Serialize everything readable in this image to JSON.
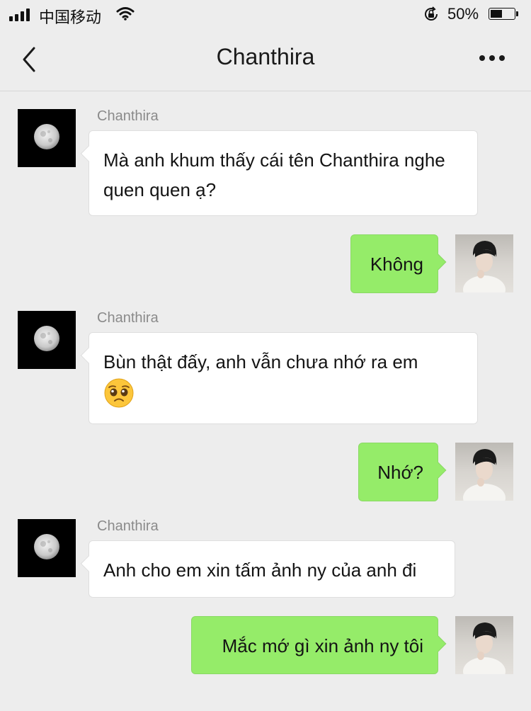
{
  "status_bar": {
    "carrier": "中国移动",
    "battery": "50%",
    "battery_level": 0.5,
    "icons": [
      "signal-icon",
      "wifi-icon",
      "rotation-lock-icon",
      "battery-icon"
    ]
  },
  "nav": {
    "title": "Chanthira",
    "icons": [
      "back-chevron-icon",
      "more-icon"
    ]
  },
  "colors": {
    "background": "#ededed",
    "incoming_bubble": "#ffffff",
    "outgoing_bubble": "#95ec69"
  },
  "messages": [
    {
      "direction": "incoming",
      "sender": "Chanthira",
      "text": "Mà anh khum thấy cái tên Chanthira nghe quen quen ạ?"
    },
    {
      "direction": "outgoing",
      "text": "Không"
    },
    {
      "direction": "incoming",
      "sender": "Chanthira",
      "text": "Bùn thật đấy, anh vẫn chưa nhớ ra em",
      "emoji": "pleading-face-emoji"
    },
    {
      "direction": "outgoing",
      "text": "Nhớ?"
    },
    {
      "direction": "incoming",
      "sender": "Chanthira",
      "text": "Anh cho em xin tấm ảnh ny của anh đi"
    },
    {
      "direction": "outgoing",
      "text": "Mắc mớ gì xin ảnh ny tôi"
    }
  ]
}
